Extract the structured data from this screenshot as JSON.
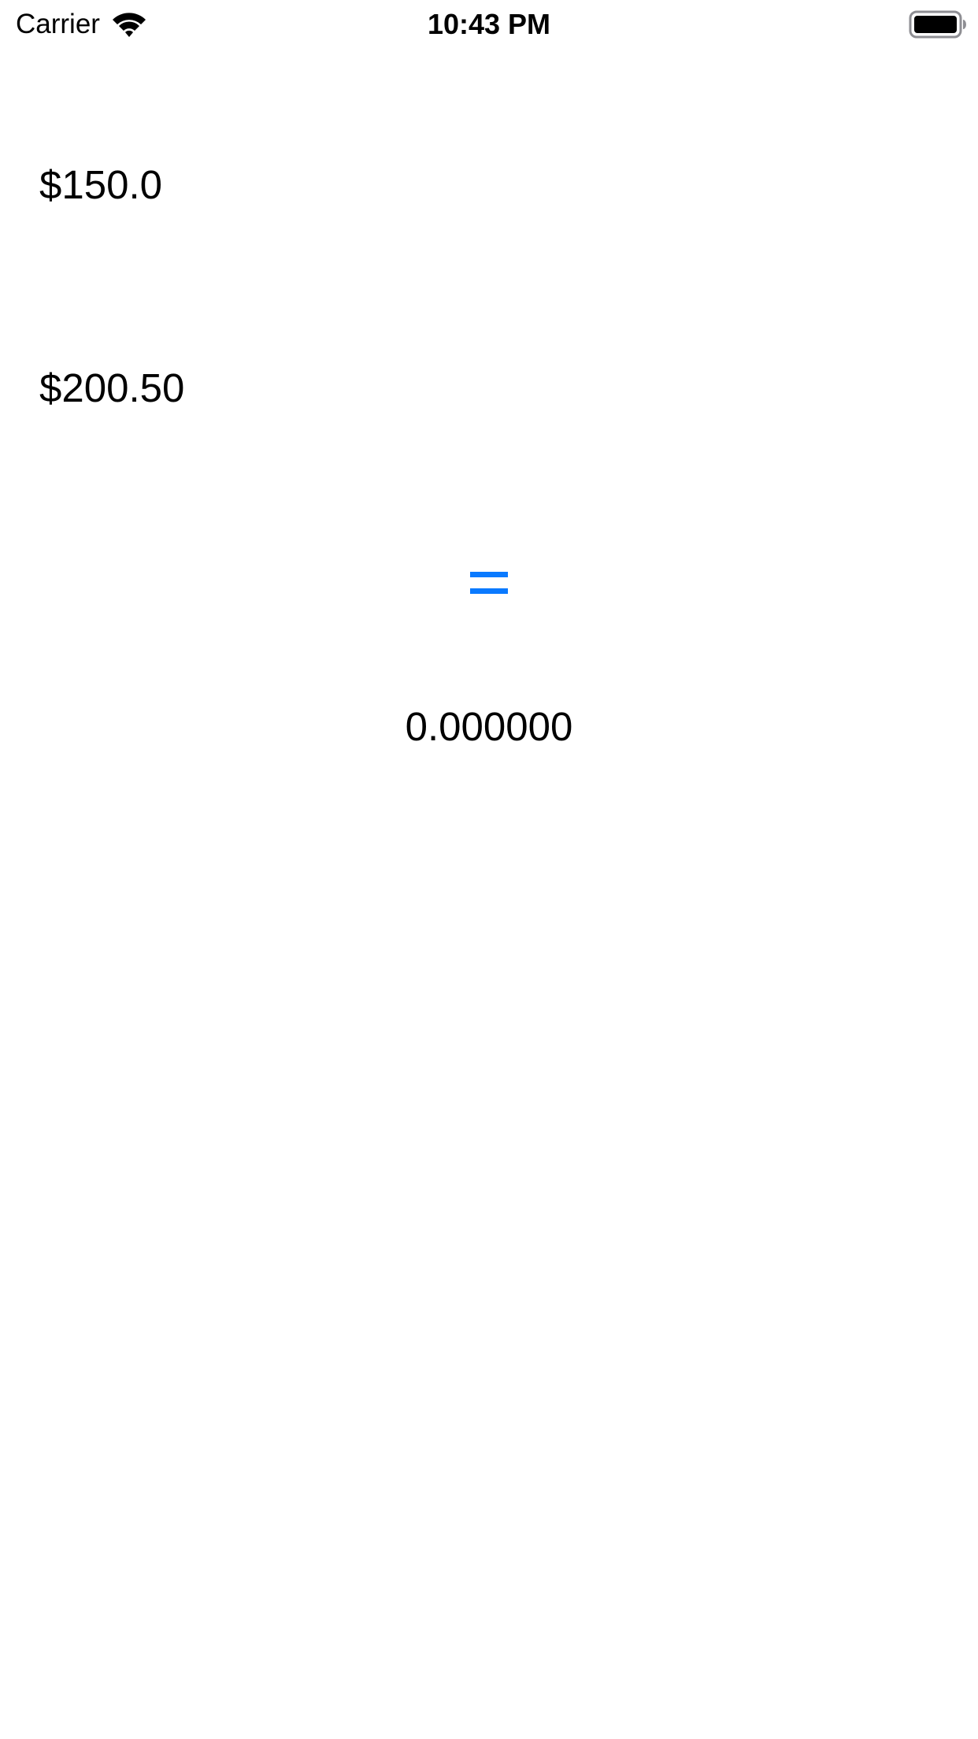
{
  "status_bar": {
    "carrier": "Carrier",
    "time": "10:43 PM",
    "wifi_icon": "wifi-icon",
    "battery_icon": "battery-icon",
    "battery_level": 1.0
  },
  "calculator": {
    "first_amount": "$150.0",
    "second_amount": "$200.50",
    "equals_button_icon": "equals-icon",
    "result": "0.000000"
  },
  "colors": {
    "accent": "#0a7aff",
    "text": "#000000",
    "background": "#ffffff"
  }
}
